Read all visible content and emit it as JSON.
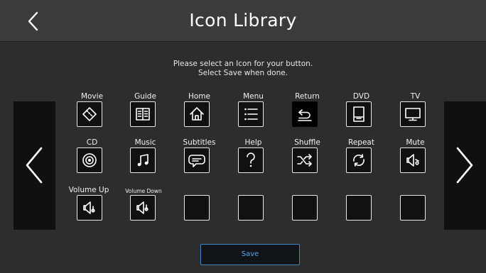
{
  "header": {
    "title": "Icon Library"
  },
  "instructions": {
    "line1": "Please select an Icon for your button.",
    "line2": "Select Save when done."
  },
  "icons": [
    {
      "label": "Movie",
      "icon": "movie-ticket-icon"
    },
    {
      "label": "Guide",
      "icon": "guide-book-icon"
    },
    {
      "label": "Home",
      "icon": "home-icon"
    },
    {
      "label": "Menu",
      "icon": "menu-list-icon"
    },
    {
      "label": "Return",
      "icon": "return-arrow-icon",
      "selected": true
    },
    {
      "label": "DVD",
      "icon": "dvd-player-icon"
    },
    {
      "label": "TV",
      "icon": "tv-monitor-icon"
    },
    {
      "label": "CD",
      "icon": "cd-disc-icon"
    },
    {
      "label": "Music",
      "icon": "music-note-icon"
    },
    {
      "label": "Subtitles",
      "icon": "subtitles-bubble-icon"
    },
    {
      "label": "Help",
      "icon": "help-question-icon"
    },
    {
      "label": "Shuffle",
      "icon": "shuffle-icon"
    },
    {
      "label": "Repeat",
      "icon": "repeat-icon"
    },
    {
      "label": "Mute",
      "icon": "mute-speaker-icon"
    },
    {
      "label": "Volume Up",
      "icon": "volume-up-speaker-icon"
    },
    {
      "label": "Volume Down",
      "icon": "volume-down-speaker-icon"
    },
    {
      "label": "",
      "icon": "empty-slot"
    },
    {
      "label": "",
      "icon": "empty-slot"
    },
    {
      "label": "",
      "icon": "empty-slot"
    },
    {
      "label": "",
      "icon": "empty-slot"
    },
    {
      "label": "",
      "icon": "empty-slot"
    }
  ],
  "save_label": "Save",
  "colors": {
    "background": "#2d2d2d",
    "header": "#3b3b3b",
    "save_accent": "#3d87c8"
  }
}
